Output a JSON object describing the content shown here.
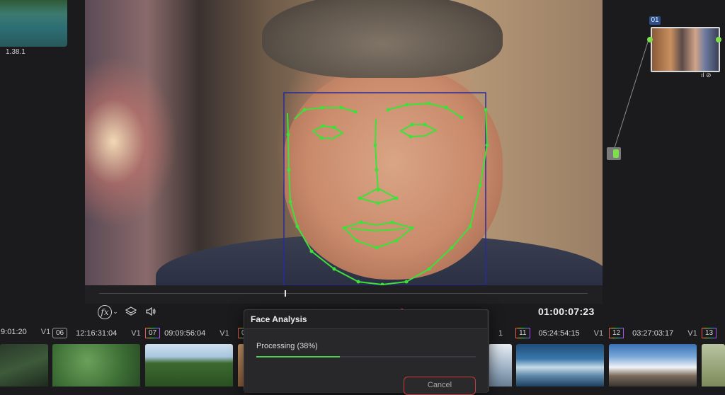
{
  "left_thumbnail": {
    "timecode": "1.38.1"
  },
  "viewer": {
    "timecode": "01:00:07:23",
    "playhead_fraction": 0.38
  },
  "toolbar": {
    "fx_label": "fx",
    "chevron": "⌄",
    "layers_icon": "layers-icon",
    "audio_icon": "speaker-icon"
  },
  "transport": {
    "icons": [
      "⏮",
      "◀",
      "■",
      "▶",
      "⏭",
      "↻"
    ]
  },
  "node_graph": {
    "node_label": "01",
    "status_icons": "ıl ⊘"
  },
  "clips": [
    {
      "timecode": ":9:01:20",
      "track": "V1"
    },
    {
      "number": "06",
      "timecode": "12:16:31:04",
      "track": "V1"
    },
    {
      "number": "07",
      "timecode": "09:09:56:04",
      "track": "V1"
    },
    {
      "number": "0"
    },
    {
      "number": "11",
      "timecode": "05:24:54:15",
      "track": "V1"
    },
    {
      "number": "12",
      "timecode": "03:27:03:17",
      "track": "V1"
    },
    {
      "number": "13"
    }
  ],
  "dialog": {
    "title": "Face Analysis",
    "processing": "Processing  (38%)",
    "progress_fraction": 0.38,
    "cancel_label": "Cancel"
  },
  "colors": {
    "tracker_green": "#3ee03a",
    "face_box": "#2a2a9a",
    "progress": "#4fd04f",
    "cancel_border": "#c53d3d"
  }
}
